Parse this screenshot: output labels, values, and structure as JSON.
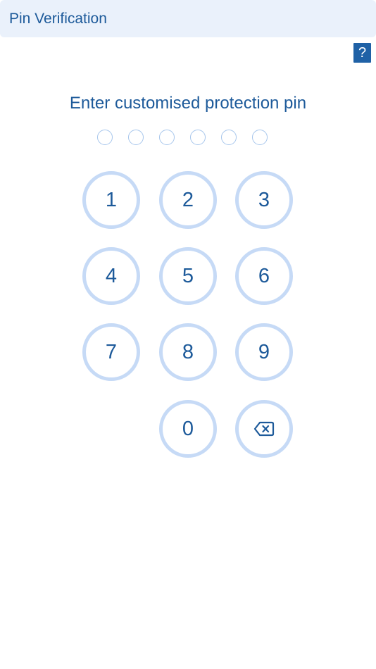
{
  "header": {
    "title": "Pin Verification"
  },
  "help": {
    "label": "?"
  },
  "prompt": {
    "text": "Enter customised protection pin"
  },
  "pin": {
    "length": 6,
    "filled": 0
  },
  "keypad": {
    "keys": [
      "1",
      "2",
      "3",
      "4",
      "5",
      "6",
      "7",
      "8",
      "9",
      "0"
    ],
    "backspace_icon": "backspace-icon"
  },
  "colors": {
    "accent": "#1d5a9a",
    "key_ring": "#c6daf6",
    "header_bg": "#eaf1fb",
    "help_bg": "#1f61a6",
    "dot_ring": "#a7c6ec"
  }
}
